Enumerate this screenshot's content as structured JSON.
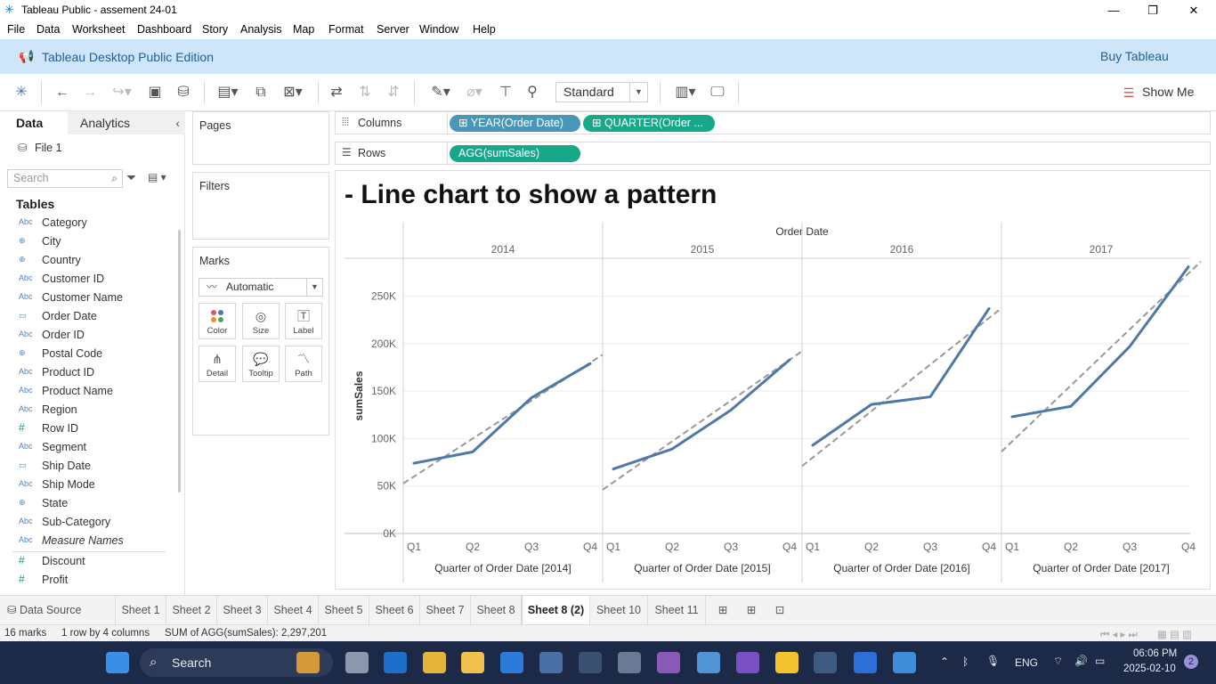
{
  "window": {
    "title": "Tableau Public - assement 24-01",
    "controls": {
      "minimize": "—",
      "restore": "❐",
      "close": "✕"
    }
  },
  "menu": [
    "File",
    "Data",
    "Worksheet",
    "Dashboard",
    "Story",
    "Analysis",
    "Map",
    "Format",
    "Server",
    "Window",
    "Help"
  ],
  "banner": {
    "text": "Tableau Desktop Public Edition",
    "buy": "Buy Tableau"
  },
  "toolbar": {
    "fit_select": "Standard",
    "show_me": "Show Me"
  },
  "datapane": {
    "tab_data": "Data",
    "tab_analytics": "Analytics",
    "datasource": "File 1",
    "search_placeholder": "Search",
    "tables_header": "Tables",
    "fields": [
      {
        "type": "Abc",
        "name": "Category"
      },
      {
        "type": "globe",
        "name": "City"
      },
      {
        "type": "globe",
        "name": "Country"
      },
      {
        "type": "Abc",
        "name": "Customer ID"
      },
      {
        "type": "Abc",
        "name": "Customer Name"
      },
      {
        "type": "date",
        "name": "Order Date"
      },
      {
        "type": "Abc",
        "name": "Order ID"
      },
      {
        "type": "globe",
        "name": "Postal Code"
      },
      {
        "type": "Abc",
        "name": "Product ID"
      },
      {
        "type": "Abc",
        "name": "Product Name"
      },
      {
        "type": "Abc",
        "name": "Region"
      },
      {
        "type": "#",
        "name": "Row ID"
      },
      {
        "type": "Abc",
        "name": "Segment"
      },
      {
        "type": "date",
        "name": "Ship Date"
      },
      {
        "type": "Abc",
        "name": "Ship Mode"
      },
      {
        "type": "globe",
        "name": "State"
      },
      {
        "type": "Abc",
        "name": "Sub-Category"
      },
      {
        "type": "Abc",
        "name": "Measure Names",
        "italic": true
      }
    ],
    "measures": [
      {
        "type": "#",
        "name": "Discount"
      },
      {
        "type": "#",
        "name": "Profit"
      }
    ]
  },
  "cards": {
    "pages": "Pages",
    "filters": "Filters",
    "marks": "Marks",
    "mark_type": "Automatic",
    "mark_buttons": [
      "Color",
      "Size",
      "Label",
      "Detail",
      "Tooltip",
      "Path"
    ]
  },
  "shelves": {
    "columns_label": "Columns",
    "rows_label": "Rows",
    "columns_pills": [
      "YEAR(Order Date)",
      "QUARTER(Order ..."
    ],
    "rows_pills": [
      "AGG(sumSales)"
    ]
  },
  "sheet": {
    "title": "- Line chart to show a pattern"
  },
  "chart_data": {
    "type": "line",
    "header": "Order Date",
    "ylabel": "sumSales",
    "ylim": [
      0,
      290000
    ],
    "yticks": [
      0,
      50000,
      100000,
      150000,
      200000,
      250000
    ],
    "ytick_labels": [
      "0K",
      "50K",
      "100K",
      "150K",
      "200K",
      "250K"
    ],
    "quarters": [
      "Q1",
      "Q2",
      "Q3",
      "Q4"
    ],
    "panels": [
      {
        "year": "2014",
        "xlabel": "Quarter of Order Date [2014]",
        "values": [
          74000,
          86000,
          143000,
          179000
        ],
        "trend": [
          60000,
          100000,
          140000,
          180000
        ]
      },
      {
        "year": "2015",
        "xlabel": "Quarter of Order Date [2015]",
        "values": [
          68000,
          89000,
          130000,
          183000
        ],
        "trend": [
          54000,
          97000,
          140000,
          183000
        ]
      },
      {
        "year": "2016",
        "xlabel": "Quarter of Order Date [2016]",
        "values": [
          93000,
          136000,
          144000,
          237000
        ],
        "trend": [
          80000,
          129000,
          178000,
          227000
        ]
      },
      {
        "year": "2017",
        "xlabel": "Quarter of Order Date [2017]",
        "values": [
          123000,
          134000,
          197000,
          281000
        ],
        "trend": [
          97000,
          156000,
          215000,
          274000
        ]
      }
    ],
    "line_color": "#4e79a7",
    "trend_color": "#999999",
    "grid": true
  },
  "tabs": {
    "datasource": "Data Source",
    "sheets": [
      "Sheet 1",
      "Sheet 2",
      "Sheet 3",
      "Sheet 4",
      "Sheet 5",
      "Sheet 6",
      "Sheet 7",
      "Sheet 8",
      "Sheet 8 (2)",
      "Sheet 10",
      "Sheet 11"
    ],
    "active": "Sheet 8 (2)"
  },
  "status": {
    "marks": "16 marks",
    "rows": "1 row by 4 columns",
    "sum": "SUM of AGG(sumSales): 2,297,201"
  },
  "taskbar": {
    "search": "Search",
    "lang": "ENG",
    "time": "06:06 PM",
    "date": "2025-02-10",
    "notifications": "2"
  }
}
